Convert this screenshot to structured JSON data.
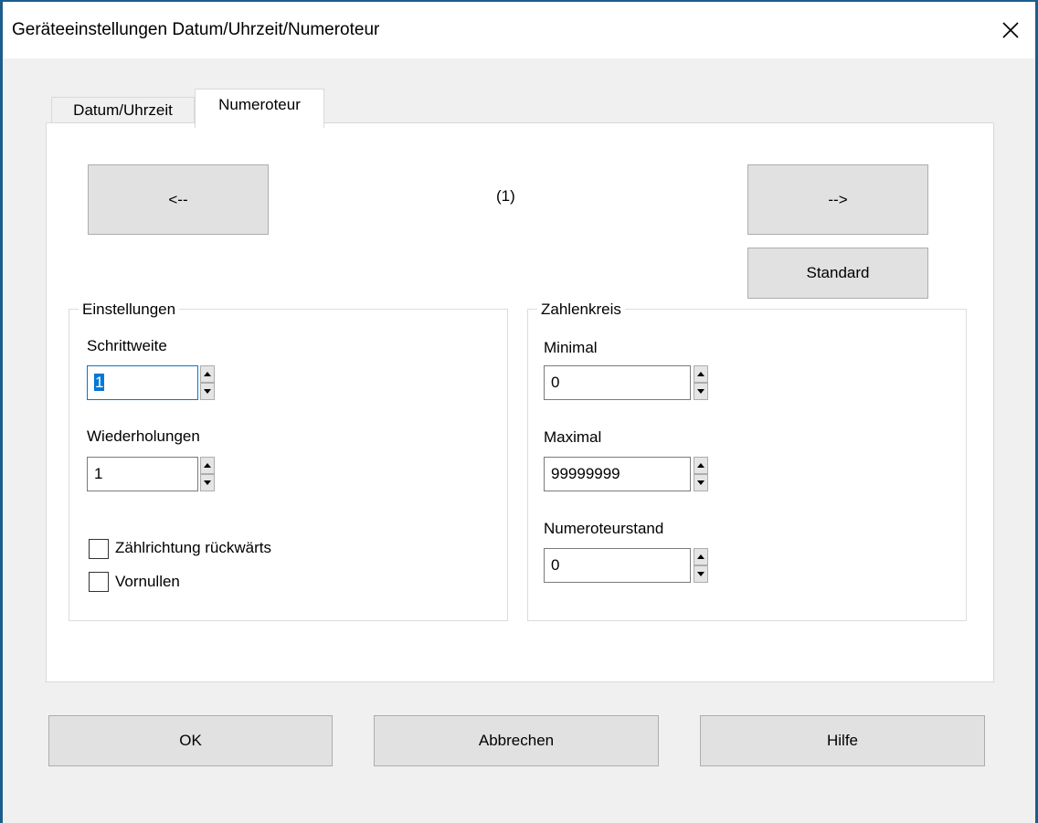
{
  "window": {
    "title": "Geräteeinstellungen Datum/Uhrzeit/Numeroteur",
    "close_icon": "close-icon"
  },
  "tabs": [
    {
      "label": "Datum/Uhrzeit",
      "active": false
    },
    {
      "label": "Numeroteur",
      "active": true
    }
  ],
  "navigation": {
    "prev_label": "<--",
    "next_label": "-->",
    "counter": "(1)",
    "standard_label": "Standard"
  },
  "einstellungen": {
    "title": "Einstellungen",
    "schrittweite_label": "Schrittweite",
    "schrittweite_value": "1",
    "wiederholungen_label": "Wiederholungen",
    "wiederholungen_value": "1",
    "rueckwaerts_label": "Zählrichtung rückwärts",
    "rueckwaerts_checked": false,
    "vornullen_label": "Vornullen",
    "vornullen_checked": false
  },
  "zahlenkreis": {
    "title": "Zahlenkreis",
    "minimal_label": "Minimal",
    "minimal_value": "0",
    "maximal_label": "Maximal",
    "maximal_value": "99999999",
    "stand_label": "Numeroteurstand",
    "stand_value": "0"
  },
  "footer": {
    "ok_label": "OK",
    "cancel_label": "Abbrechen",
    "help_label": "Hilfe"
  },
  "colors": {
    "window_border": "#1c5d8c",
    "focus_accent": "#0078d7",
    "button_face": "#e1e1e1"
  }
}
